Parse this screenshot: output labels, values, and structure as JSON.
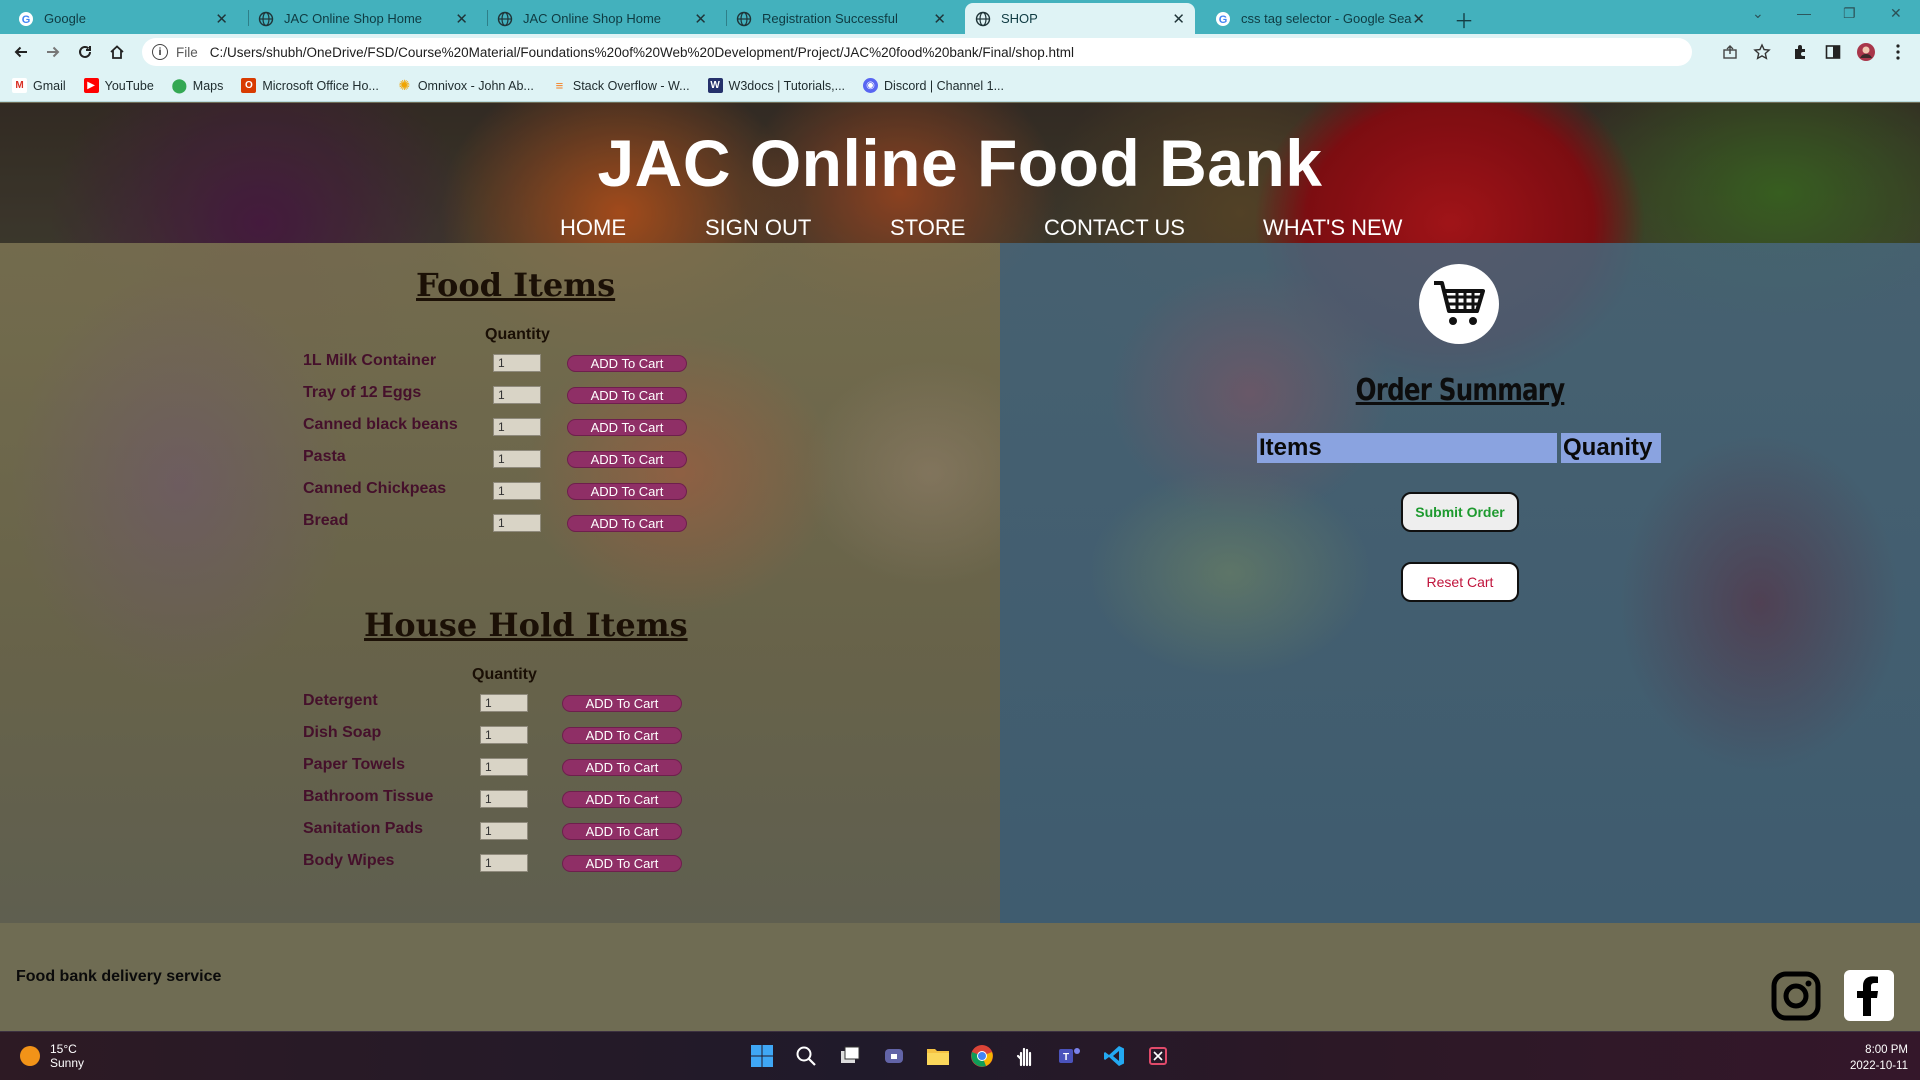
{
  "browser": {
    "tabs": [
      {
        "title": "Google",
        "active": false
      },
      {
        "title": "JAC Online Shop Home",
        "active": false
      },
      {
        "title": "JAC Online Shop Home",
        "active": false
      },
      {
        "title": "Registration Successful",
        "active": false
      },
      {
        "title": "SHOP",
        "active": true
      },
      {
        "title": "css tag selector - Google Search",
        "active": false
      }
    ],
    "address": {
      "scheme": "File",
      "url": "C:/Users/shubh/OneDrive/FSD/Course%20Material/Foundations%20of%20Web%20Development/Project/JAC%20food%20bank/Final/shop.html"
    },
    "bookmarks": [
      {
        "label": "Gmail",
        "icon": "gmail-icon",
        "color": "#d93025"
      },
      {
        "label": "YouTube",
        "icon": "youtube-icon",
        "color": "#ff0000"
      },
      {
        "label": "Maps",
        "icon": "maps-icon",
        "color": "#34a853"
      },
      {
        "label": "Microsoft Office Ho...",
        "icon": "office-icon",
        "color": "#d83b01"
      },
      {
        "label": "Omnivox - John Ab...",
        "icon": "omnivox-icon",
        "color": "#f0a400"
      },
      {
        "label": "Stack Overflow - W...",
        "icon": "stackoverflow-icon",
        "color": "#f48024"
      },
      {
        "label": "W3docs | Tutorials,...",
        "icon": "w3docs-icon",
        "color": "#25316b"
      },
      {
        "label": "Discord | Channel 1...",
        "icon": "discord-icon",
        "color": "#5865f2"
      }
    ]
  },
  "site": {
    "title": "JAC Online Food Bank",
    "nav": [
      "HOME",
      "SIGN OUT",
      "STORE",
      "CONTACT US",
      "WHAT'S NEW"
    ]
  },
  "food": {
    "title": "Food Items",
    "quantity_label": "Quantity",
    "items": [
      {
        "name": "1L Milk Container",
        "qty": "1",
        "button": "ADD To Cart"
      },
      {
        "name": "Tray of 12 Eggs",
        "qty": "1",
        "button": "ADD To Cart"
      },
      {
        "name": "Canned black beans",
        "qty": "1",
        "button": "ADD To Cart"
      },
      {
        "name": "Pasta",
        "qty": "1",
        "button": "ADD To Cart"
      },
      {
        "name": "Canned Chickpeas",
        "qty": "1",
        "button": "ADD To Cart"
      },
      {
        "name": "Bread",
        "qty": "1",
        "button": "ADD To Cart"
      }
    ]
  },
  "household": {
    "title": "House Hold Items",
    "quantity_label": "Quantity",
    "items": [
      {
        "name": "Detergent",
        "qty": "1",
        "button": "ADD To Cart"
      },
      {
        "name": "Dish Soap",
        "qty": "1",
        "button": "ADD To Cart"
      },
      {
        "name": "Paper Towels",
        "qty": "1",
        "button": "ADD To Cart"
      },
      {
        "name": "Bathroom Tissue",
        "qty": "1",
        "button": "ADD To Cart"
      },
      {
        "name": "Sanitation Pads",
        "qty": "1",
        "button": "ADD To Cart"
      },
      {
        "name": "Body Wipes",
        "qty": "1",
        "button": "ADD To Cart"
      }
    ]
  },
  "order": {
    "title": "Order Summary",
    "col_items": "Items",
    "col_quantity": "Quanity",
    "submit": "Submit Order",
    "reset": "Reset Cart"
  },
  "footer": {
    "text": "Food bank delivery service"
  },
  "taskbar": {
    "temp": "15°C",
    "weather": "Sunny",
    "time": "8:00 PM",
    "date": "2022-10-11"
  },
  "colors": {
    "tabbar": "#43b1bd",
    "add_button": "#8f2f66",
    "order_header": "#8aa3e0",
    "submit_text": "#1e9a2f",
    "reset_text": "#c0143c"
  }
}
